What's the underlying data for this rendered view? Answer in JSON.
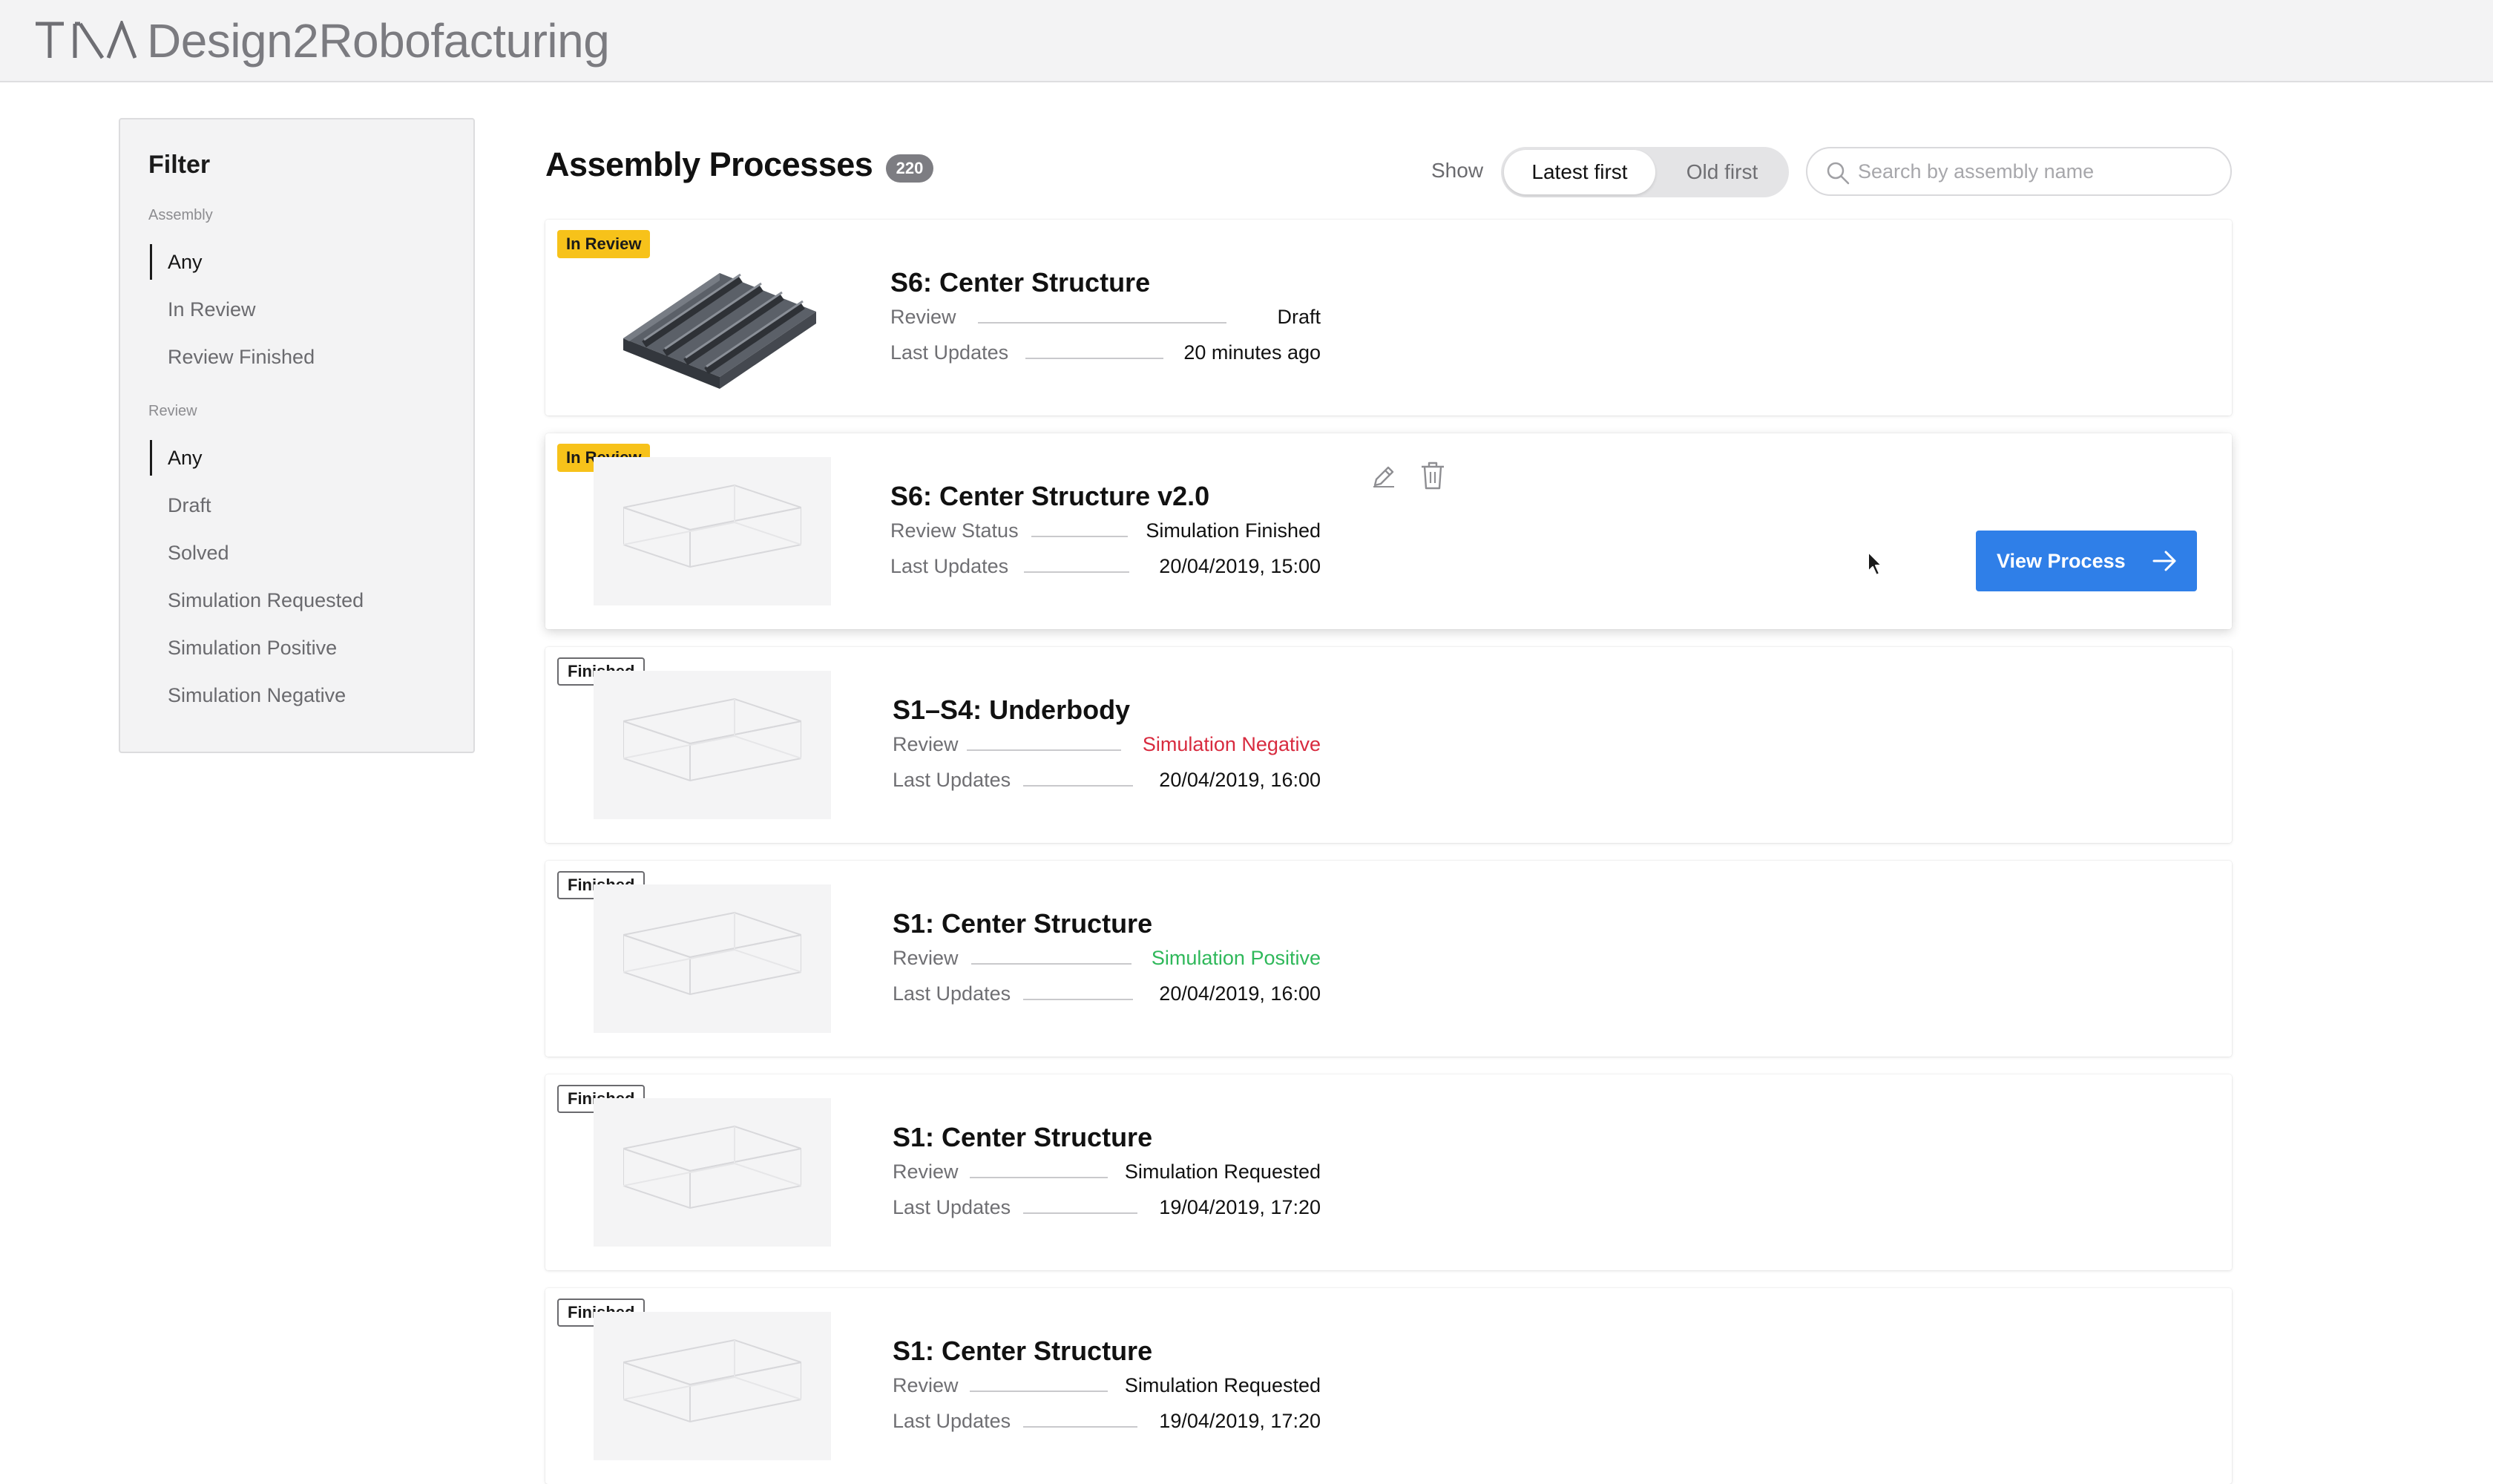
{
  "app": {
    "title": "Design2Robofacturing",
    "logo_text": "TKA"
  },
  "filter": {
    "title": "Filter",
    "assembly_label": "Assembly",
    "assembly_items": [
      "Any",
      "In Review",
      "Review Finished"
    ],
    "review_label": "Review",
    "review_items": [
      "Any",
      "Draft",
      "Solved",
      "Simulation Requested",
      "Simulation Positive",
      "Simulation Negative"
    ]
  },
  "header": {
    "title": "Assembly Processes",
    "count": "220",
    "show_label": "Show",
    "sort_options": [
      "Latest first",
      "Old first"
    ],
    "search_placeholder": "Search by assembly name"
  },
  "cards": [
    {
      "status": "In Review",
      "title": "S6: Center Structure",
      "field1_label": "Review",
      "field1_value": "Draft",
      "field2_label": "Last Updates",
      "field2_value": "20 minutes ago"
    },
    {
      "status": "In Review",
      "title": "S6: Center Structure v2.0",
      "field1_label": "Review Status",
      "field1_value": "Simulation Finished",
      "field2_label": "Last Updates",
      "field2_value": "20/04/2019, 15:00",
      "action": "View Process"
    },
    {
      "status": "Finished",
      "title": "S1–S4: Underbody",
      "field1_label": "Review",
      "field1_value": "Simulation Negative",
      "field2_label": "Last Updates",
      "field2_value": "20/04/2019, 16:00"
    },
    {
      "status": "Finished",
      "title": "S1: Center Structure",
      "field1_label": "Review",
      "field1_value": "Simulation Positive",
      "field2_label": "Last Updates",
      "field2_value": "20/04/2019, 16:00"
    },
    {
      "status": "Finished",
      "title": "S1: Center Structure",
      "field1_label": "Review",
      "field1_value": "Simulation Requested",
      "field2_label": "Last Updates",
      "field2_value": "19/04/2019, 17:20"
    },
    {
      "status": "Finished",
      "title": "S1: Center Structure",
      "field1_label": "Review",
      "field1_value": "Simulation Requested",
      "field2_label": "Last Updates",
      "field2_value": "19/04/2019, 17:20"
    }
  ],
  "colors": {
    "accent": "#2f7fe8",
    "in_review": "#f7c21a",
    "negative": "#d82b3f",
    "positive": "#2fb85a"
  },
  "icons": [
    "search-icon",
    "edit-icon",
    "trash-icon",
    "arrow-right-icon",
    "cursor-icon"
  ]
}
